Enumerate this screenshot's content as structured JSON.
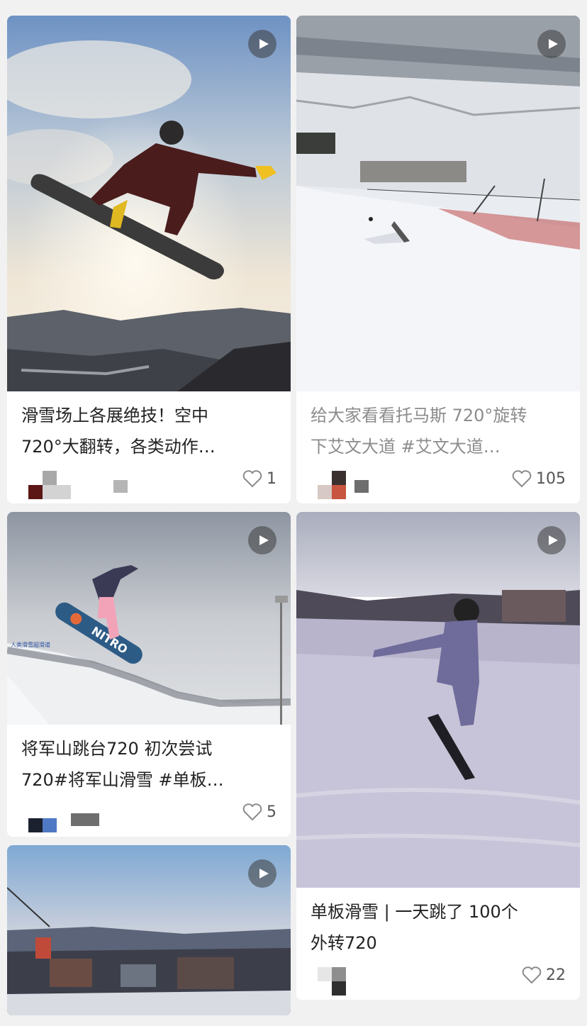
{
  "feed": {
    "cards": [
      {
        "title_line1": "滑雪场上各展绝技！空中",
        "title_line2": "720°大翻转，各类动作…",
        "likes": "1",
        "has_video": true
      },
      {
        "title_line1": "给大家看看托马斯 720°旋转",
        "title_line2": "下艾文大道 #艾文大道…",
        "likes": "105",
        "has_video": true
      },
      {
        "title_line1": "将军山跳台720 初次尝试",
        "title_line2": "720#将军山滑雪 #单板…",
        "likes": "5",
        "has_video": true,
        "board_brand": "NITRO",
        "sign_text": "人类滑雪超滑道"
      },
      {
        "title_line1": "单板滑雪 | 一天跳了 100个",
        "title_line2": "外转720",
        "likes": "22",
        "has_video": true
      },
      {
        "has_video": true
      }
    ]
  },
  "colors": {
    "heart": "#8a8a8a",
    "play_bg": "#3c3c3c"
  }
}
